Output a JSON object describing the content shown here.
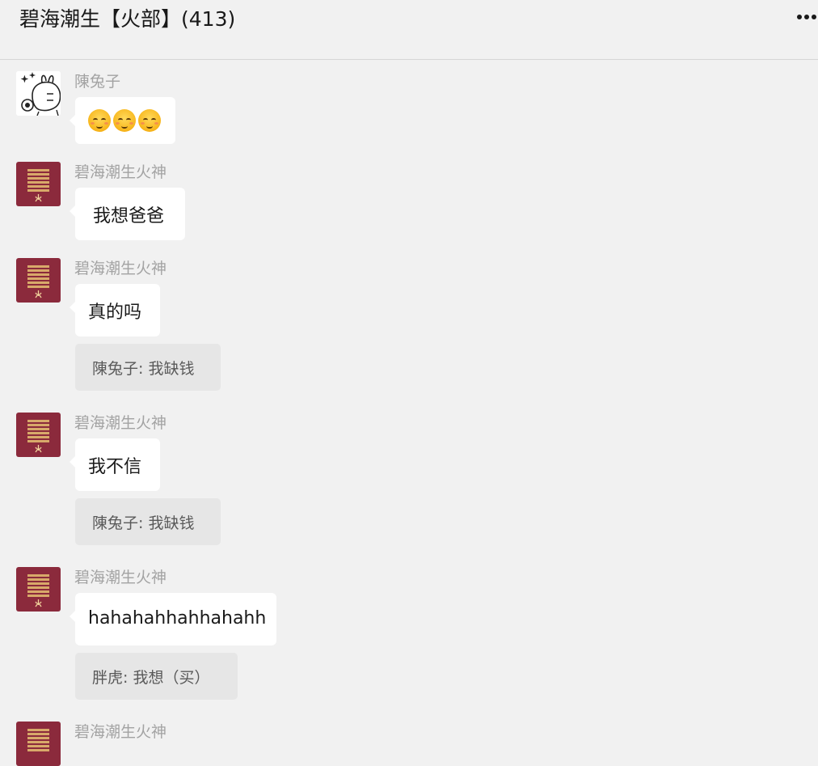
{
  "header": {
    "title": "碧海潮生【火部】(413)"
  },
  "messages": [
    {
      "sender": "陳兔子",
      "avatar_icon": "bunny-sticker-icon",
      "emojis": [
        "blush-emoji",
        "blush-emoji",
        "blush-emoji"
      ]
    },
    {
      "sender": "碧海潮生火神",
      "avatar_icon": "hexagram-fire-icon",
      "text": "我想爸爸"
    },
    {
      "sender": "碧海潮生火神",
      "avatar_icon": "hexagram-fire-icon",
      "text": "真的吗",
      "quote": "陳兔子: 我缺钱"
    },
    {
      "sender": "碧海潮生火神",
      "avatar_icon": "hexagram-fire-icon",
      "text": "我不信",
      "quote": "陳兔子: 我缺钱"
    },
    {
      "sender": "碧海潮生火神",
      "avatar_icon": "hexagram-fire-icon",
      "text": "hahahahhahhahahh",
      "quote": "胖虎: 我想（买）"
    },
    {
      "sender": "碧海潮生火神",
      "avatar_icon": "hexagram-fire-icon"
    }
  ],
  "colors": {
    "background": "#f1f1f1",
    "bubble": "#ffffff",
    "quote": "#e6e6e6",
    "avatar": "#8b2a3c",
    "avatar_lines": "#d8a96a"
  }
}
